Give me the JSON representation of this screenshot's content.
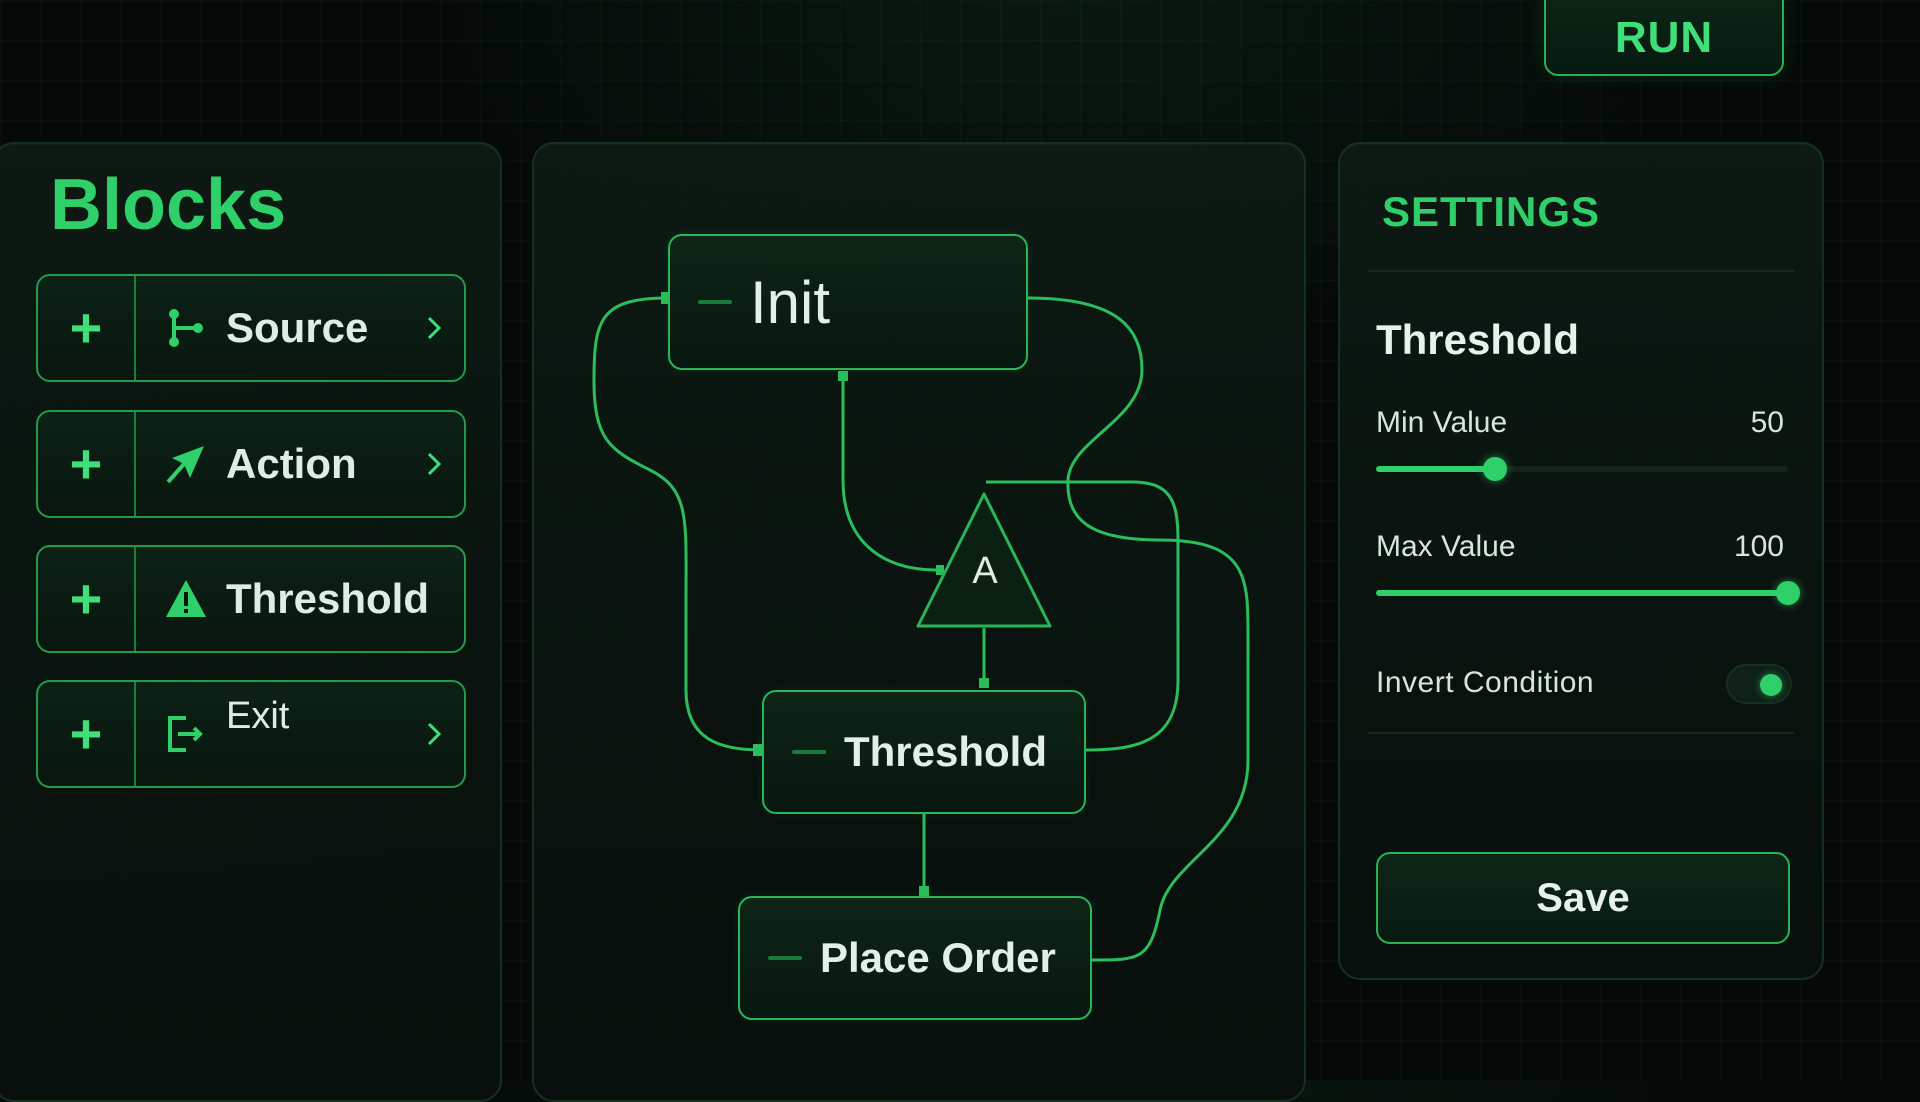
{
  "toolbar": {
    "run_label": "RUN"
  },
  "blocks": {
    "title": "Blocks",
    "items": [
      {
        "label": "Source",
        "icon": "branch-icon"
      },
      {
        "label": "Action",
        "icon": "arrow-icon"
      },
      {
        "label": "Threshold",
        "icon": "warning-icon"
      },
      {
        "label": "Exit",
        "icon": "exit-icon"
      }
    ]
  },
  "canvas": {
    "nodes": [
      {
        "label": "Init"
      },
      {
        "label": "A"
      },
      {
        "label": "Threshold"
      },
      {
        "label": "Place Order"
      }
    ]
  },
  "settings": {
    "title": "SETTINGS",
    "section": "Threshold",
    "min": {
      "label": "Min Value",
      "value": "50",
      "fraction": 0.29
    },
    "max": {
      "label": "Max Value",
      "value": "100",
      "fraction": 1.0
    },
    "invert": {
      "label": "Invert Condition",
      "on": true
    },
    "save_label": "Save"
  },
  "colors": {
    "accent": "#2fd06a",
    "border": "#28b658",
    "background": "#050a08"
  }
}
